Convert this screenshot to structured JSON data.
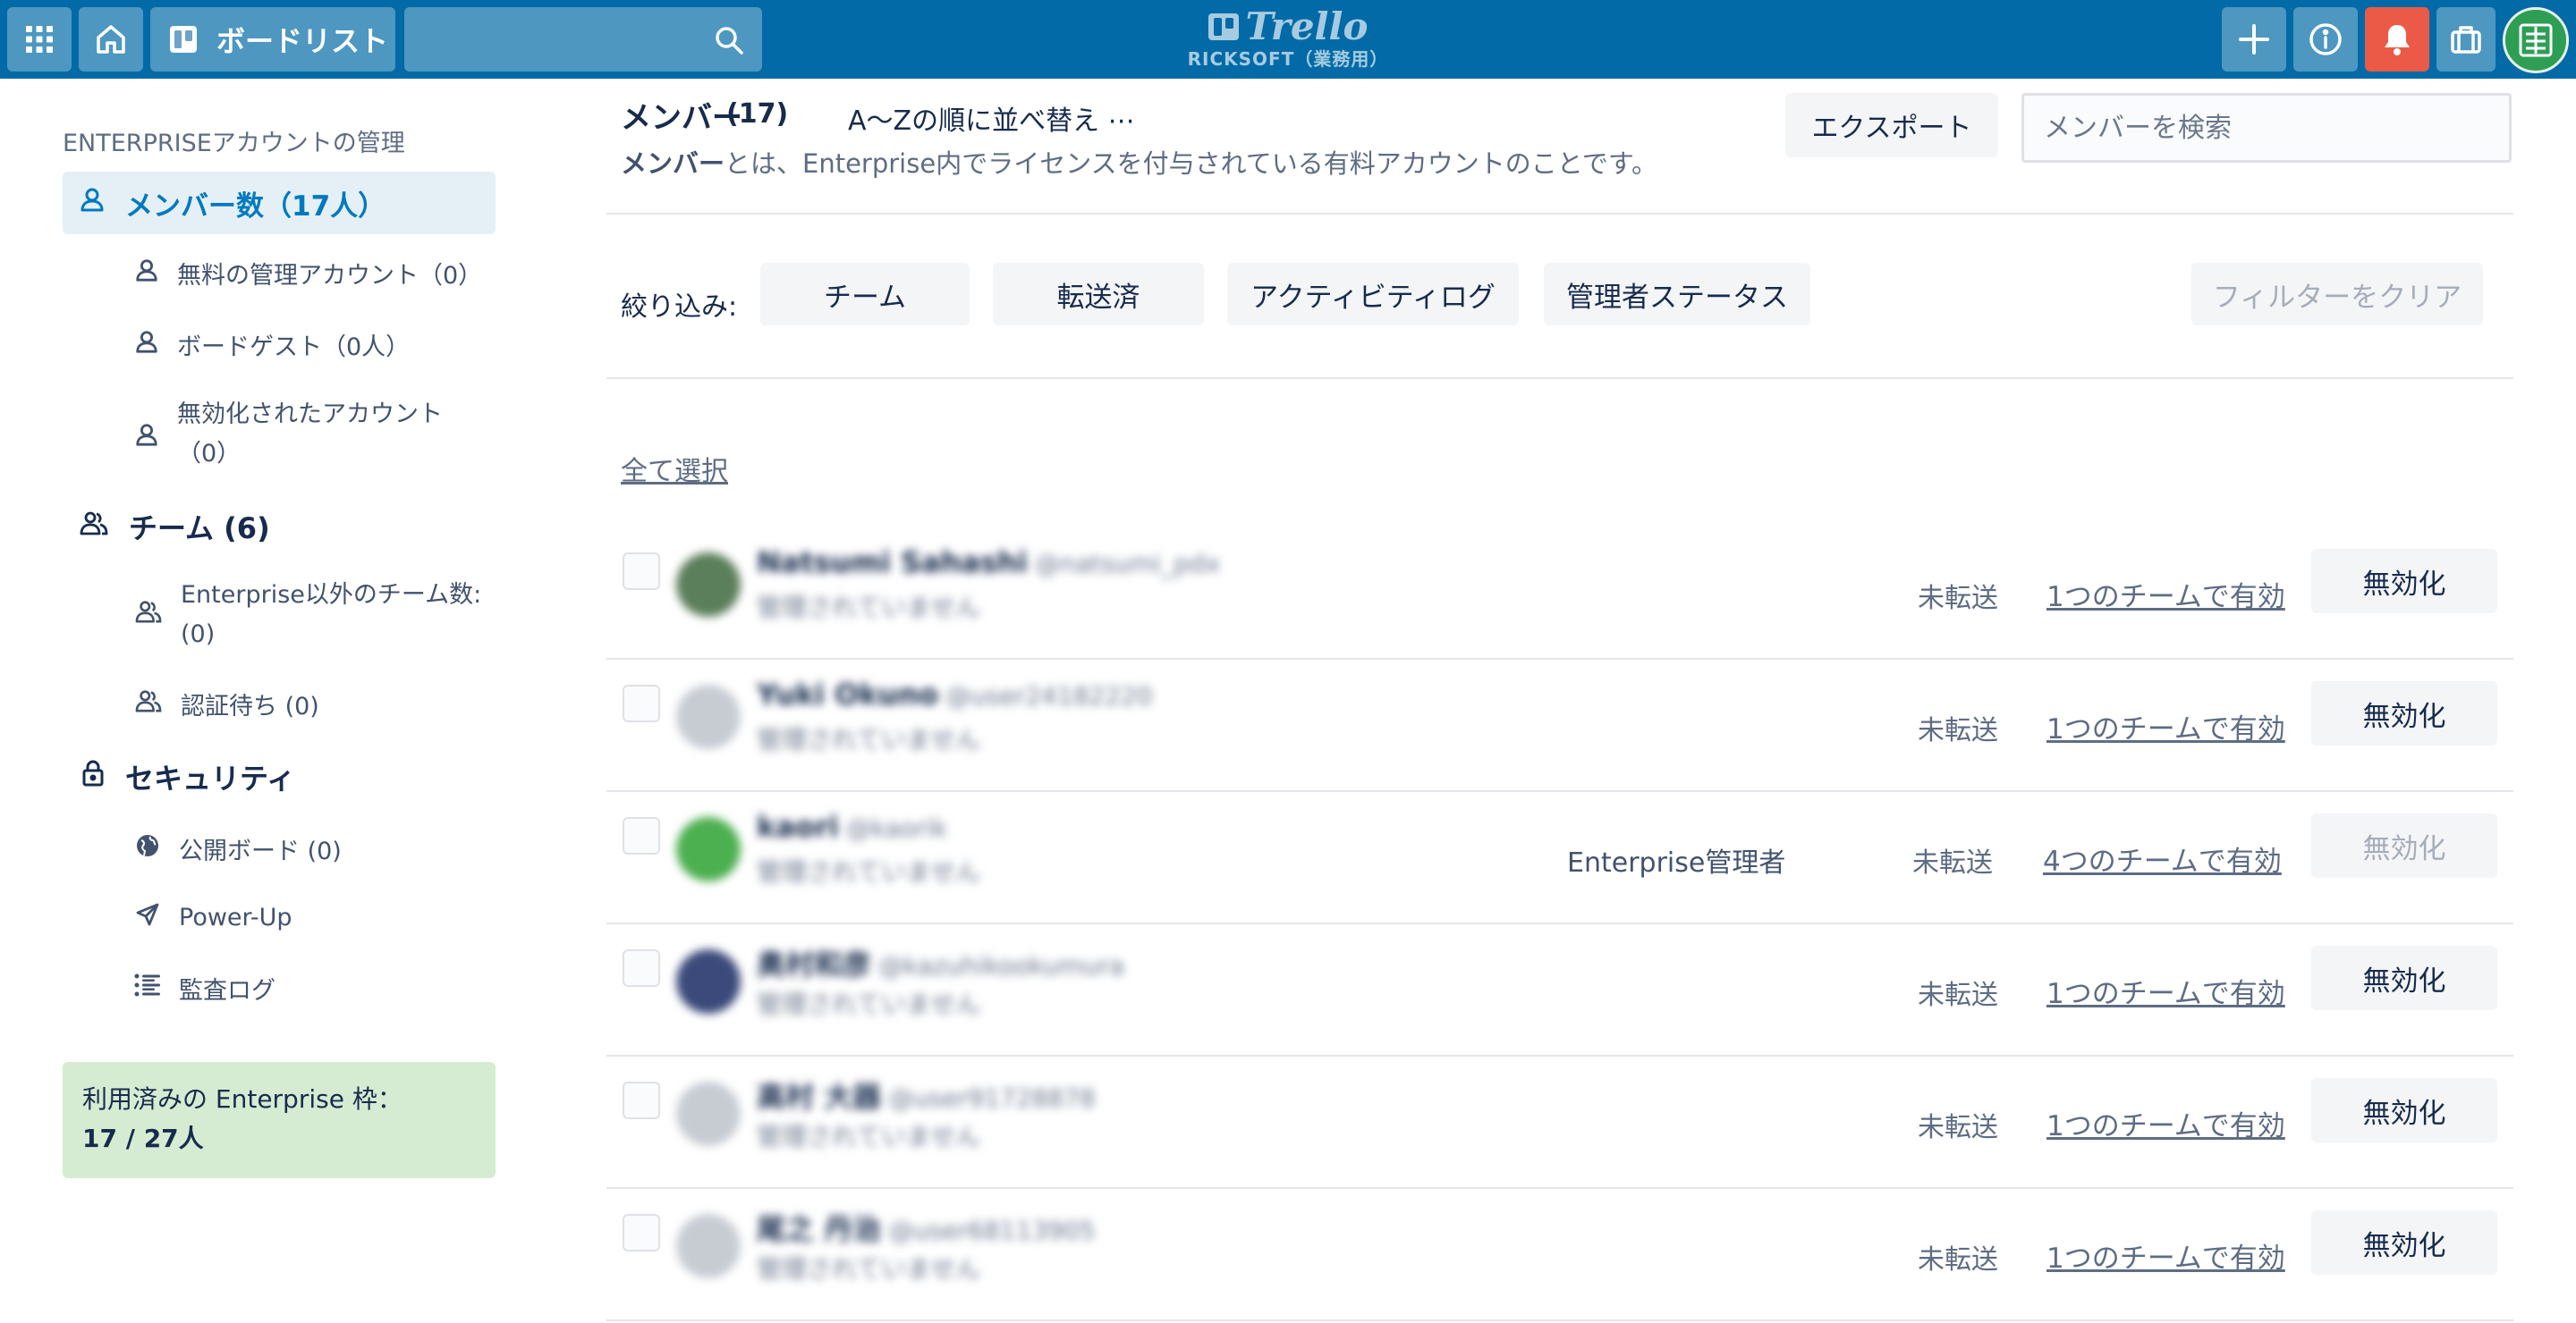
{
  "header": {
    "boards_label": "ボードリスト",
    "logo_brand": "Trello",
    "logo_workspace": "RICKSOFT（業務用）",
    "colors": {
      "bar": "#026aa7",
      "bell": "#eb5a46",
      "avatar": "#2e9e55"
    },
    "icons": [
      "apps-grid-icon",
      "home-icon",
      "board-icon",
      "search-icon",
      "plus-icon",
      "info-icon",
      "bell-icon",
      "briefcase-icon"
    ]
  },
  "sidebar": {
    "heading": "ENTERPRISEアカウントの管理",
    "members_active": "メンバー数（17人）",
    "free_admins": "無料の管理アカウント（0）",
    "board_guests": "ボードゲスト（0人）",
    "deactivated_1": "無効化されたアカウント",
    "deactivated_2": "（0）",
    "teams": "チーム (6)",
    "non_enterprise_teams_1": "Enterprise以外のチーム数:",
    "non_enterprise_teams_2": "(0)",
    "pending": "認証待ち (0)",
    "security": "セキュリティ",
    "public_boards": "公開ボード (0)",
    "powerups": "Power-Up",
    "audit_log": "監査ログ",
    "quota_label": "利用済みの Enterprise 枠：",
    "quota_value": "17 / 27人"
  },
  "main": {
    "title": "メンバー",
    "count": "(17)",
    "sort_label": "A〜Zの順に並べ替え ⋯",
    "description_bold": "メンバー",
    "description_rest": "とは、Enterprise内でライセンスを付与されている有料アカウントのことです。",
    "export_label": "エクスポート",
    "search_placeholder": "メンバーを検索",
    "filter_label": "絞り込み:",
    "filters": [
      "チーム",
      "転送済",
      "アクティビティログ",
      "管理者ステータス"
    ],
    "clear_filters": "フィルターをクリア",
    "select_all": "全て選択"
  },
  "members": [
    {
      "name": "Natsumi Sahashi",
      "username": "@natsumi_pdx",
      "status": "管理されていません",
      "role": "",
      "transfer": "未転送",
      "teams": "1つのチームで有効",
      "action": "無効化",
      "avatar_color": "#5b7f5a"
    },
    {
      "name": "Yuki Okuno",
      "username": "@user24182220",
      "status": "管理されていません",
      "role": "",
      "transfer": "未転送",
      "teams": "1つのチームで有効",
      "action": "無効化",
      "avatar_color": "#c7ccd3"
    },
    {
      "name": "kaori",
      "username": "@kaorik",
      "status": "管理されていません",
      "role": "Enterprise管理者",
      "transfer": "未転送",
      "teams": "4つのチームで有効",
      "action": "無効化",
      "avatar_color": "#4caf50"
    },
    {
      "name": "奥村和彦",
      "username": "@kazuhikookumura",
      "status": "管理されていません",
      "role": "",
      "transfer": "未転送",
      "teams": "1つのチームで有効",
      "action": "無効化",
      "avatar_color": "#3b4a7a"
    },
    {
      "name": "高村 大器",
      "username": "@user91728878",
      "status": "管理されていません",
      "role": "",
      "transfer": "未転送",
      "teams": "1つのチームで有効",
      "action": "無効化",
      "avatar_color": "#c7ccd3"
    },
    {
      "name": "尾之 丹治",
      "username": "@user68113905",
      "status": "管理されていません",
      "role": "",
      "transfer": "未転送",
      "teams": "1つのチームで有効",
      "action": "無効化",
      "avatar_color": "#c7ccd3"
    }
  ]
}
